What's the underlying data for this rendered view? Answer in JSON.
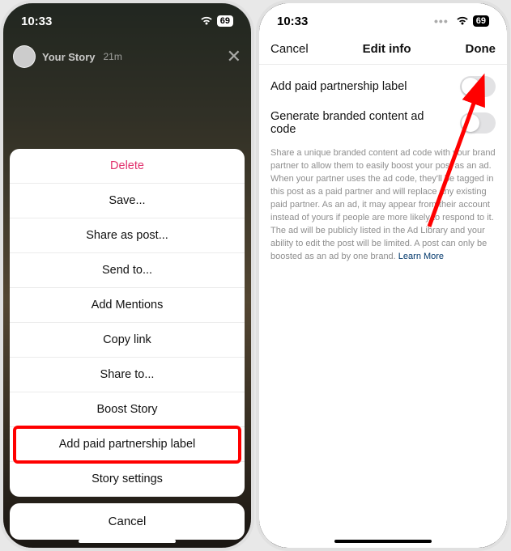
{
  "statusbar": {
    "time": "10:33",
    "battery": "69"
  },
  "left": {
    "story": {
      "title": "Your Story",
      "age": "21m"
    },
    "sheet": {
      "delete": "Delete",
      "save": "Save...",
      "share_as_post": "Share as post...",
      "send_to": "Send to...",
      "add_mentions": "Add Mentions",
      "copy_link": "Copy link",
      "share_to": "Share to...",
      "boost_story": "Boost Story",
      "add_paid_partnership": "Add paid partnership label",
      "story_settings": "Story settings"
    },
    "cancel": "Cancel"
  },
  "right": {
    "nav": {
      "cancel": "Cancel",
      "title": "Edit info",
      "done": "Done"
    },
    "row1": {
      "label": "Add paid partnership label"
    },
    "row2": {
      "label": "Generate branded content ad code"
    },
    "desc": "Share a unique branded content ad code with your brand partner to allow them to easily boost your post as an ad. When your partner uses the ad code, they'll be tagged in this post as a paid partner and will replace any existing paid partner. As an ad, it may appear from their account instead of yours if people are more likely to respond to it. The ad will be publicly listed in the Ad Library and your ability to edit the post will be limited. A post can only be boosted as an ad by one brand.",
    "learn_more": "Learn More"
  }
}
